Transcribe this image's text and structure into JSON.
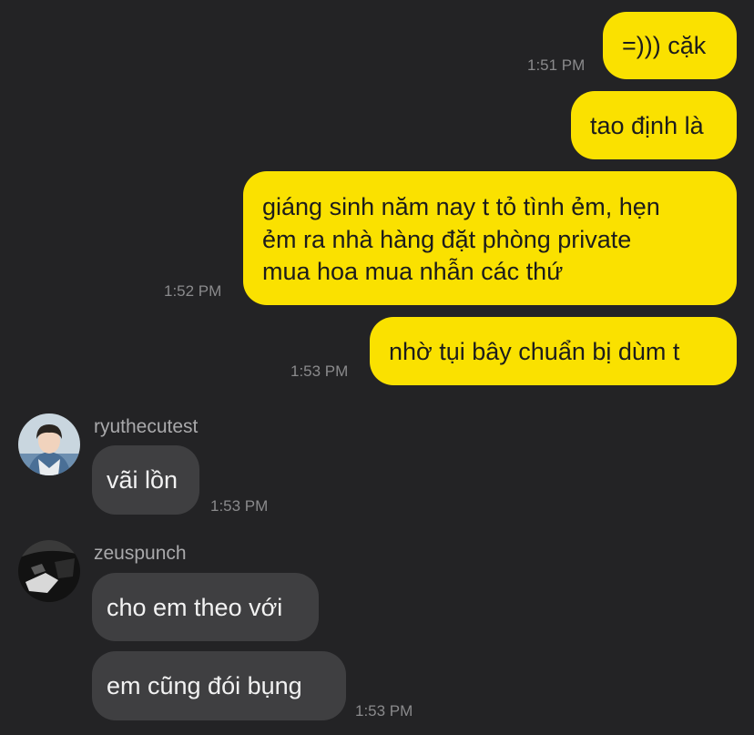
{
  "chat": {
    "outgoing": [
      {
        "text": "=))) cặk",
        "time": "1:51 PM"
      },
      {
        "text": "tao định là",
        "time": ""
      },
      {
        "text": "giáng sinh năm nay t tỏ tình ẻm, hẹn\nẻm ra nhà hàng đặt phòng private\nmua hoa mua nhẫn các thứ",
        "time": "1:52 PM"
      },
      {
        "text": "nhờ tụi bây chuẩn bị dùm t",
        "time": "1:53 PM"
      }
    ],
    "incoming": [
      {
        "sender": "ryuthecutest",
        "avatar_icon": "user-photo-icon",
        "messages": [
          {
            "text": "vãi lồn",
            "time": "1:53 PM"
          }
        ]
      },
      {
        "sender": "zeuspunch",
        "avatar_icon": "user-photo-dark-icon",
        "messages": [
          {
            "text": "cho em theo với",
            "time": ""
          },
          {
            "text": "em cũng đói bụng",
            "time": "1:53 PM"
          }
        ]
      }
    ]
  },
  "colors": {
    "background": "#232325",
    "outgoing_bubble": "#fae100",
    "incoming_bubble": "#3f3f41",
    "timestamp": "#8a8a8c"
  }
}
